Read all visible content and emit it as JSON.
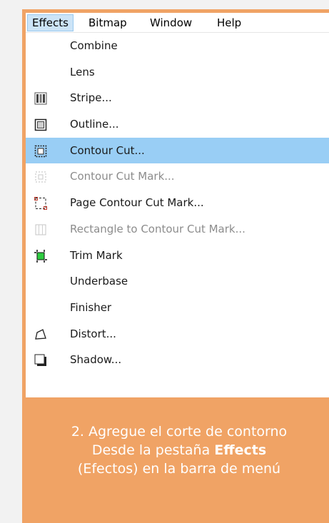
{
  "menubar": [
    {
      "label": "Effects"
    },
    {
      "label": "Bitmap"
    },
    {
      "label": "Window"
    },
    {
      "label": "Help"
    }
  ],
  "menu_items": [
    {
      "label": "Combine",
      "icon": "none",
      "state": "normal"
    },
    {
      "label": "Lens",
      "icon": "none",
      "state": "normal"
    },
    {
      "label": "Stripe...",
      "icon": "stripe-icon",
      "state": "normal"
    },
    {
      "label": "Outline...",
      "icon": "outline-icon",
      "state": "normal"
    },
    {
      "label": "Contour Cut...",
      "icon": "contour-cut-icon",
      "state": "highlighted"
    },
    {
      "label": "Contour Cut Mark...",
      "icon": "contour-cut-mark-icon",
      "state": "disabled"
    },
    {
      "label": "Page Contour Cut Mark...",
      "icon": "page-contour-cut-mark-icon",
      "state": "normal"
    },
    {
      "label": "Rectangle to Contour Cut Mark...",
      "icon": "rectangle-contour-icon",
      "state": "disabled"
    },
    {
      "label": "Trim Mark",
      "icon": "trim-mark-icon",
      "state": "normal"
    },
    {
      "label": "Underbase",
      "icon": "none",
      "state": "normal"
    },
    {
      "label": "Finisher",
      "icon": "none",
      "state": "normal"
    },
    {
      "label": "Distort...",
      "icon": "distort-icon",
      "state": "normal"
    },
    {
      "label": "Shadow...",
      "icon": "shadow-icon",
      "state": "normal"
    }
  ],
  "caption": {
    "title": "2. Agregue el corte de contorno",
    "line1_pre": "Desde la pestaña ",
    "line1_bold": "Effects",
    "line2": "(Efectos) en la barra de menú"
  },
  "colors": {
    "background": "#f2f2f2",
    "accent": "#f0a365",
    "highlight": "#99cef5"
  }
}
